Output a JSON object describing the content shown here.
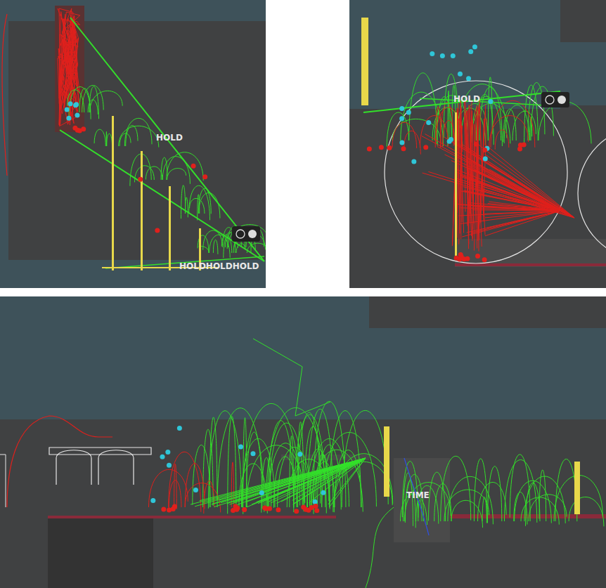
{
  "panels": [
    {
      "labels": [
        {
          "text": "HOLD"
        },
        {
          "text": "HOLDHOLDHOLD"
        }
      ]
    },
    {
      "labels": [
        {
          "text": "HOLD"
        }
      ]
    },
    {
      "labels": [
        {
          "text": "TIME"
        }
      ]
    }
  ]
}
